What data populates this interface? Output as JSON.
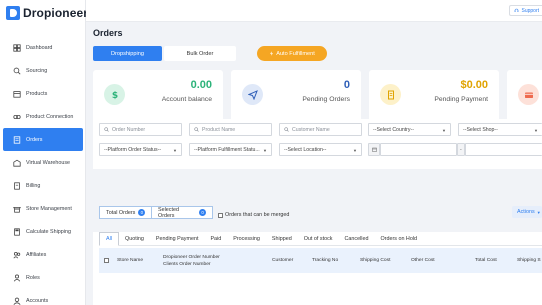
{
  "brand": {
    "name": "Dropioneer"
  },
  "topbar": {
    "support_label": "Support"
  },
  "sidebar": {
    "items": [
      {
        "label": "Dashboard",
        "icon": "dashboard-icon"
      },
      {
        "label": "Sourcing",
        "icon": "sourcing-icon"
      },
      {
        "label": "Products",
        "icon": "box-icon"
      },
      {
        "label": "Product Connection",
        "icon": "link-icon"
      },
      {
        "label": "Orders",
        "icon": "orders-icon"
      },
      {
        "label": "Virtual Warehouse",
        "icon": "warehouse-icon"
      },
      {
        "label": "Billing",
        "icon": "billing-icon"
      },
      {
        "label": "Store Management",
        "icon": "store-icon"
      },
      {
        "label": "Calculate Shipping",
        "icon": "calculator-icon"
      },
      {
        "label": "Affiliates",
        "icon": "affiliates-icon"
      },
      {
        "label": "Roles",
        "icon": "roles-icon"
      },
      {
        "label": "Accounts",
        "icon": "accounts-icon"
      }
    ],
    "active_index": 4
  },
  "page": {
    "title": "Orders"
  },
  "mode_tabs": {
    "dropshipping": "Dropshipping",
    "bulk": "Bulk Order",
    "auto": "Auto Fulfillment"
  },
  "stats": [
    {
      "value": "0.00",
      "label": "Account balance",
      "color": "#2db37a",
      "icon": "dollar-icon"
    },
    {
      "value": "0",
      "label": "Pending Orders",
      "color": "#2f5fb8",
      "icon": "send-icon"
    },
    {
      "value": "$0.00",
      "label": "Pending Payment",
      "color": "#e0a300",
      "icon": "receipt-icon"
    },
    {
      "value": "",
      "label": "",
      "color": "#ee6a4e",
      "icon": "card-icon"
    }
  ],
  "filters": {
    "order_number": "Order Number",
    "product_name": "Product Name",
    "customer_name": "Customer Name",
    "country": "--Select Country--",
    "shop": "--Select Shop--",
    "platform_order_status": "--Platform Order Status--",
    "platform_fulfillment_status": "--Platform Fulfillment Statu...",
    "location": "--Select Location--",
    "date_separator": "-"
  },
  "summary": {
    "total_orders_label": "Total Orders",
    "total_orders_count": "0",
    "selected_orders_label": "Selected Orders",
    "selected_orders_count": "0",
    "merge_label": "Orders that can be merged",
    "actions_label": "Actions"
  },
  "order_tabs": [
    "All",
    "Quoting",
    "Pending Payment",
    "Paid",
    "Processing",
    "Shipped",
    "Out of stock",
    "Cancelled",
    "Orders on Hold"
  ],
  "table": {
    "store_name": "Store Name",
    "order_number_line1": "Dropioneer Order Number",
    "order_number_line2": "Clients Order Number",
    "customer": "Customer",
    "tracking": "Tracking No",
    "shipping_cost": "Shipping Cost",
    "other_cost": "Other Cost",
    "total_cost": "Total Cost",
    "shipping_status": "Shipping S"
  },
  "colors": {
    "accent": "#2f7ff0",
    "warning": "#f5a623"
  }
}
